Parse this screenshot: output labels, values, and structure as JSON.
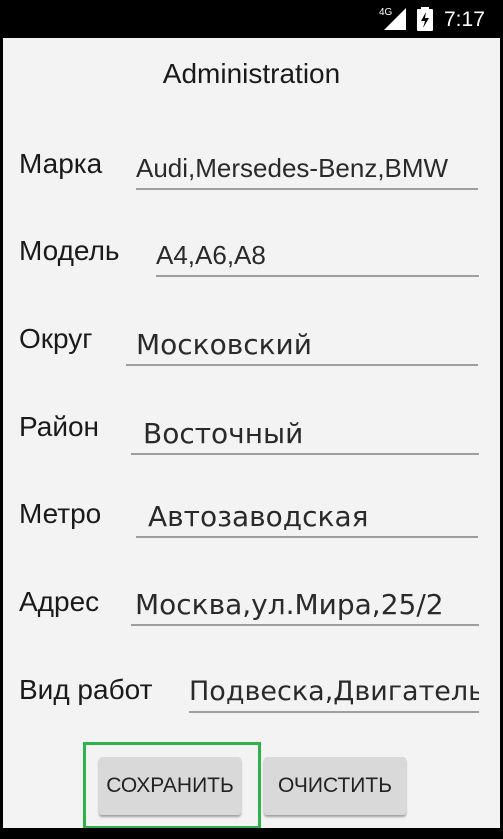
{
  "status_bar": {
    "network": "4G",
    "time": "7:17"
  },
  "title": "Administration",
  "form": [
    {
      "label": "Марка",
      "value": "Audi,Mersedes-Benz,BMW"
    },
    {
      "label": "Модель",
      "value": "A4,A6,A8"
    },
    {
      "label": "Округ",
      "value": "Московский"
    },
    {
      "label": "Район",
      "value": "Восточный"
    },
    {
      "label": "Метро",
      "value": "Автозаводская"
    },
    {
      "label": "Адрес",
      "value": "Москва,ул.Мира,25/2"
    },
    {
      "label": "Вид работ",
      "value": "Подвеска,Двигатель"
    }
  ],
  "buttons": {
    "save": "СОХРАНИТЬ",
    "clear": "ОЧИСТИТЬ"
  },
  "colors": {
    "highlight": "#2db34a"
  }
}
